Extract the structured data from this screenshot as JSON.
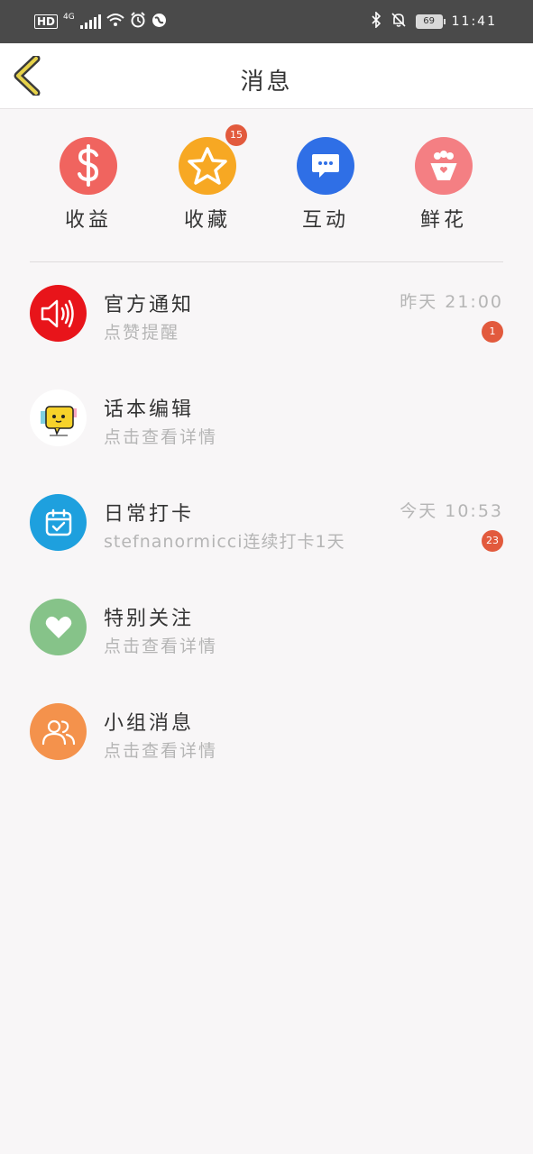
{
  "status_bar": {
    "network_badge": "HD",
    "network_type": "4G",
    "battery_level": "69",
    "time": "11:41",
    "icons": [
      "hd-icon",
      "signal-icon",
      "wifi-icon",
      "alarm-icon",
      "vpn-icon",
      "bluetooth-icon",
      "mute-bell-icon",
      "battery-icon"
    ]
  },
  "header": {
    "title": "消息",
    "back_icon": "chevron-left-icon"
  },
  "shortcuts": [
    {
      "label": "收益",
      "icon": "dollar-icon",
      "color": "#f0645f",
      "badge": ""
    },
    {
      "label": "收藏",
      "icon": "star-icon",
      "color": "#f7a823",
      "badge": "15"
    },
    {
      "label": "互动",
      "icon": "chat-bubble-icon",
      "color": "#2f6fe6",
      "badge": ""
    },
    {
      "label": "鲜花",
      "icon": "flower-bouquet-icon",
      "color": "#f47f83",
      "badge": ""
    }
  ],
  "messages": [
    {
      "title": "官方通知",
      "subtitle": "点赞提醒",
      "time": "昨天 21:00",
      "badge": "1",
      "icon": "speaker-icon",
      "color": "#e8141a"
    },
    {
      "title": "话本编辑",
      "subtitle": "点击查看详情",
      "time": "",
      "badge": "",
      "icon": "editor-avatar-icon",
      "color": "#ffffff"
    },
    {
      "title": "日常打卡",
      "subtitle": "stefnanormicci连续打卡1天",
      "time": "今天 10:53",
      "badge": "23",
      "icon": "calendar-check-icon",
      "color": "#1ea0de"
    },
    {
      "title": "特别关注",
      "subtitle": "点击查看详情",
      "time": "",
      "badge": "",
      "icon": "heart-icon",
      "color": "#86c389"
    },
    {
      "title": "小组消息",
      "subtitle": "点击查看详情",
      "time": "",
      "badge": "",
      "icon": "group-users-icon",
      "color": "#f4924c"
    }
  ],
  "colors": {
    "badge": "#e25a3d",
    "back_arrow_fill": "#e6d24a"
  }
}
